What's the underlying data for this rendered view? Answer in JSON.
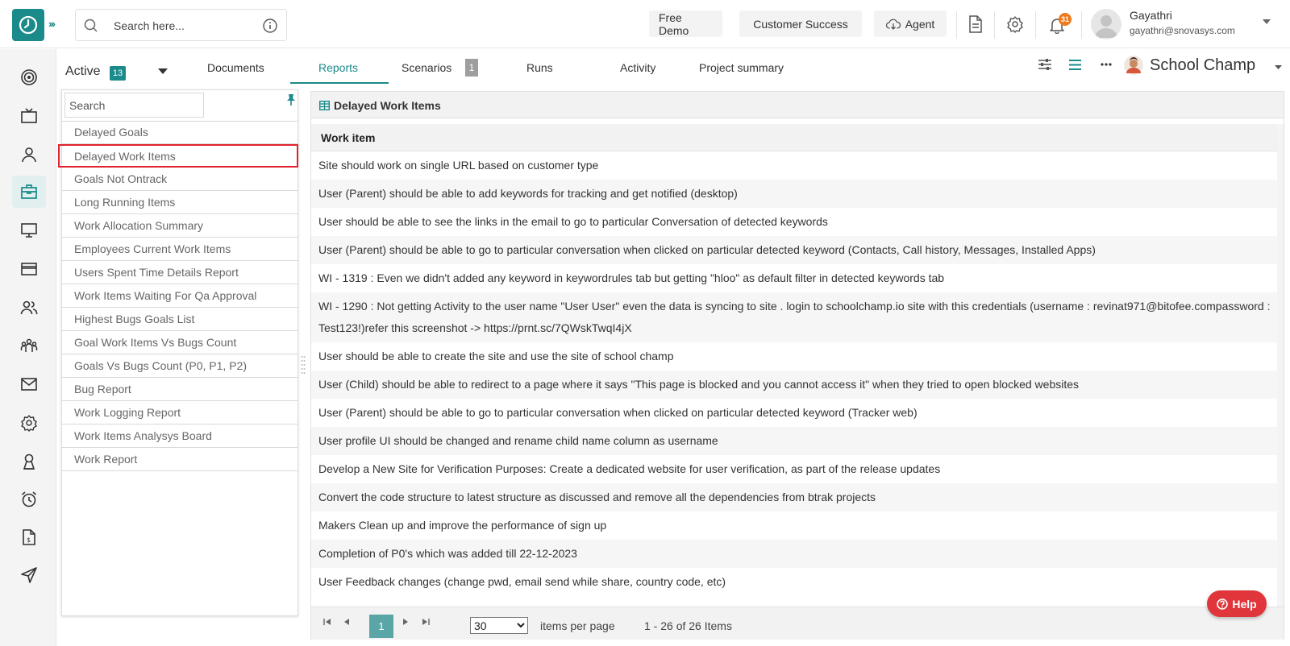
{
  "header": {
    "search_placeholder": "Search here...",
    "free_demo": "Free Demo",
    "customer_success": "Customer Success",
    "agent": "Agent",
    "notification_count": "31",
    "user_name": "Gayathri",
    "user_email": "gayathri@snovasys.com"
  },
  "rail": {
    "items": [
      "target-icon",
      "tv-icon",
      "user-icon",
      "briefcase-icon",
      "monitor-icon",
      "card-icon",
      "users-icon",
      "team-icon",
      "mail-icon",
      "settings-icon",
      "badge-icon",
      "alarm-icon",
      "invoice-icon",
      "send-icon"
    ],
    "active_index": 3
  },
  "tabs": {
    "status_label": "Active",
    "status_count": "13",
    "items": [
      "Documents",
      "Reports",
      "Scenarios",
      "Runs",
      "Activity",
      "Project summary"
    ],
    "selected": "Reports",
    "scenarios_count": "1",
    "project_name": "School Champ"
  },
  "reports_list": {
    "search_placeholder": "Search",
    "items": [
      "Delayed Goals",
      "Delayed Work Items",
      "Goals Not Ontrack",
      "Long Running Items",
      "Work Allocation Summary",
      "Employees Current Work Items",
      "Users Spent Time Details Report",
      "Work Items Waiting For Qa Approval",
      "Highest Bugs Goals List",
      "Goal Work Items Vs Bugs Count",
      "Goals Vs Bugs Count (P0, P1, P2)",
      "Bug Report",
      "Work Logging Report",
      "Work Items Analysys Board",
      "Work Report"
    ],
    "selected": "Delayed Work Items"
  },
  "grid": {
    "title": "Delayed Work Items",
    "column": "Work item",
    "rows": [
      "Site should work on single URL based on customer type",
      "User (Parent) should be able to add keywords for tracking and get notified (desktop)",
      "User should be able to see the links in the email to go to particular Conversation of detected keywords",
      "User (Parent) should be able to go to particular conversation when clicked on particular detected keyword (Contacts, Call history, Messages, Installed Apps)",
      "WI - 1319 : Even we didn't added any keyword in keywordrules tab but getting \"hloo\" as default filter in detected keywords tab",
      "WI - 1290 : Not getting Activity to the user name \"User User\" even the data is syncing to site . login to schoolchamp.io site with this credentials (username : revinat971@bitofee.compassword : Test123!)refer this screenshot -> https://prnt.sc/7QWskTwqI4jX",
      "User should be able to create the site and use the site of school champ",
      "User (Child) should be able to redirect to a page where it says \"This page is blocked and you cannot access it\" when they tried to open blocked websites",
      "User (Parent) should be able to go to particular conversation when clicked on particular detected keyword (Tracker web)",
      "User profile UI should be changed and rename child name column as username",
      "Develop a New Site for Verification Purposes: Create a dedicated website for user verification, as part of the release updates",
      "Convert the code structure to latest structure as discussed and remove all the dependencies from btrak projects",
      "Makers Clean up and improve the performance of sign up",
      "Completion of P0's which was added till 22-12-2023",
      "User Feedback changes (change pwd, email send while share, country code, etc)"
    ]
  },
  "pager": {
    "current_page": "1",
    "page_size": "30",
    "per_page_label": "items per page",
    "range": "1 - 26 of 26 Items"
  },
  "help_label": "Help",
  "colors": {
    "accent": "#1a8a8a",
    "highlight_border": "#e0232e",
    "help": "#e0353a",
    "badge": "#f07a1c"
  }
}
